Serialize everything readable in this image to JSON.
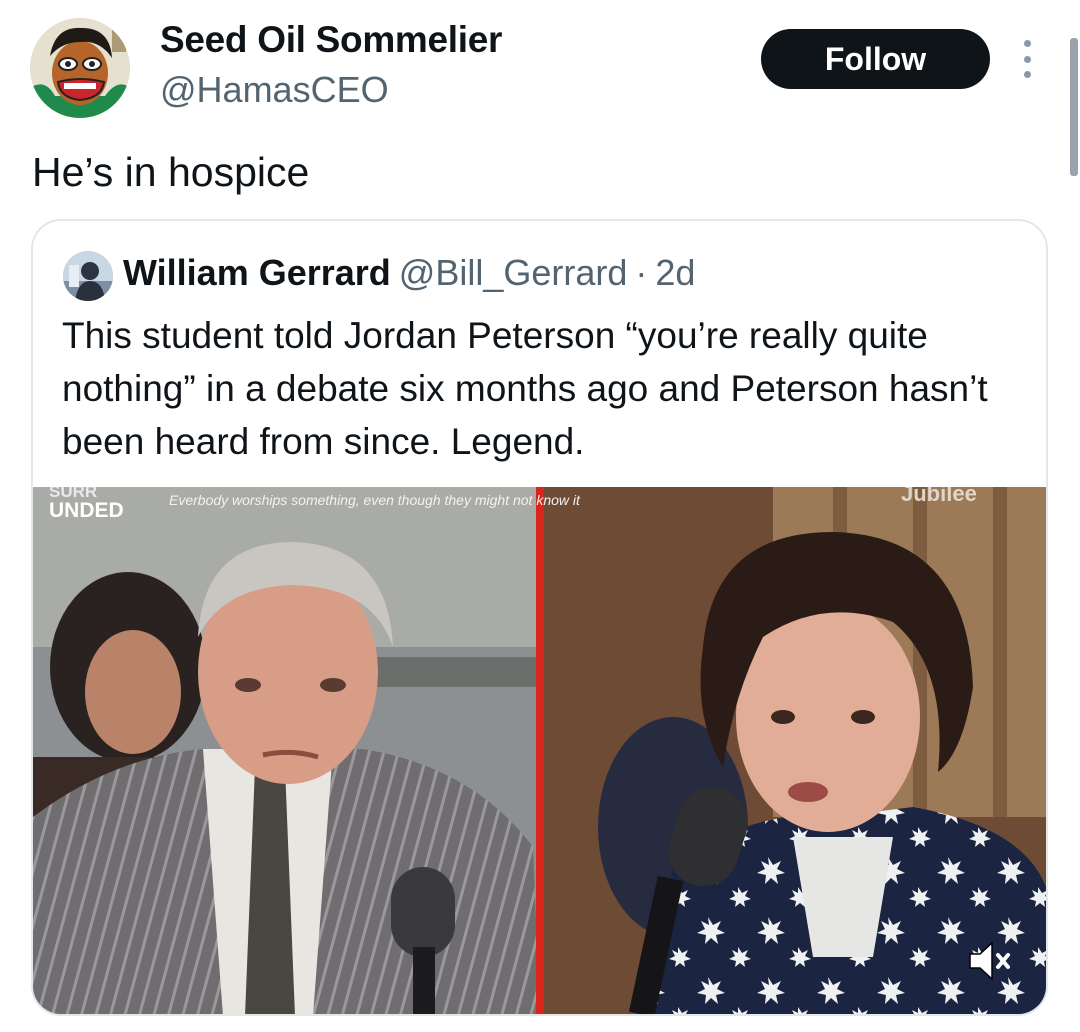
{
  "author": {
    "display_name": "Seed Oil Sommelier",
    "handle": "@HamasCEO",
    "avatar_icon": "cartoon-avatar"
  },
  "follow_label": "Follow",
  "tweet_text": "He’s in hospice",
  "quote": {
    "display_name": "William Gerrard",
    "handle": "@Bill_Gerrard",
    "separator": "·",
    "time": "2d",
    "text": "This student told Jordan Peterson “you’re really quite nothing” in a debate six months ago and Peterson hasn’t been heard from since. Legend.",
    "media": {
      "logo_left": "SURR UNDED",
      "caption": "Everbody worships something, even though they might not know it",
      "logo_right": "Jubilee"
    }
  },
  "colors": {
    "text_primary": "#0f1419",
    "text_secondary": "#536471",
    "follow_bg": "#0f1419",
    "card_border": "#e3e7ea",
    "divider": "#d9261c"
  }
}
